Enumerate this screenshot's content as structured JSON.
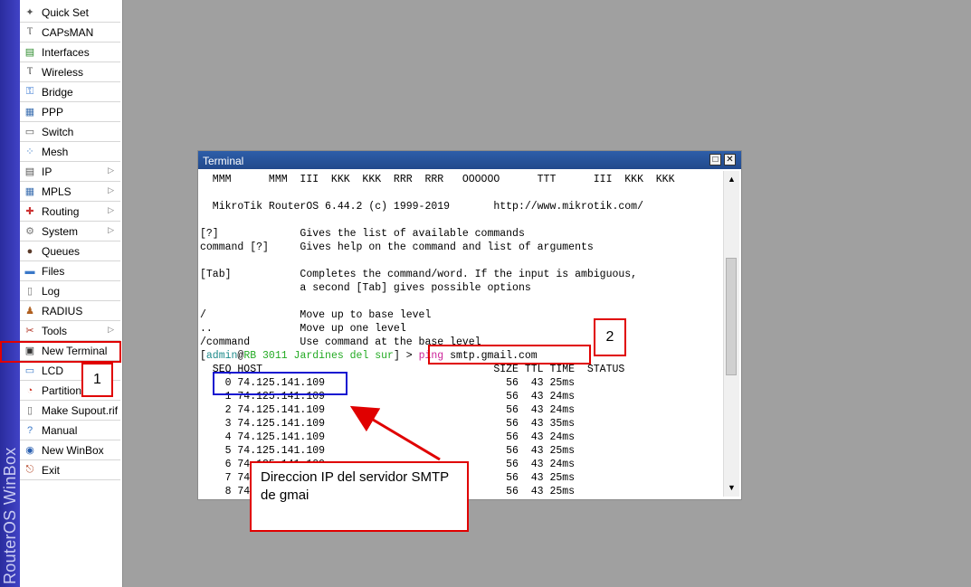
{
  "app": {
    "brand": "RouterOS WinBox"
  },
  "sidebar": {
    "items": [
      {
        "label": "Quick Set",
        "icon": "wand-icon",
        "submenu": false
      },
      {
        "label": "CAPsMAN",
        "icon": "antenna-icon",
        "submenu": false
      },
      {
        "label": "Interfaces",
        "icon": "ethernet-icon",
        "submenu": false
      },
      {
        "label": "Wireless",
        "icon": "wireless-icon",
        "submenu": false
      },
      {
        "label": "Bridge",
        "icon": "bridge-icon",
        "submenu": false
      },
      {
        "label": "PPP",
        "icon": "ppp-icon",
        "submenu": false
      },
      {
        "label": "Switch",
        "icon": "switch-icon",
        "submenu": false
      },
      {
        "label": "Mesh",
        "icon": "mesh-icon",
        "submenu": false
      },
      {
        "label": "IP",
        "icon": "ip-icon",
        "submenu": true
      },
      {
        "label": "MPLS",
        "icon": "mpls-icon",
        "submenu": true
      },
      {
        "label": "Routing",
        "icon": "routing-icon",
        "submenu": true
      },
      {
        "label": "System",
        "icon": "gear-icon",
        "submenu": true
      },
      {
        "label": "Queues",
        "icon": "queues-icon",
        "submenu": false
      },
      {
        "label": "Files",
        "icon": "folder-icon",
        "submenu": false
      },
      {
        "label": "Log",
        "icon": "log-icon",
        "submenu": false
      },
      {
        "label": "RADIUS",
        "icon": "radius-icon",
        "submenu": false
      },
      {
        "label": "Tools",
        "icon": "tools-icon",
        "submenu": true
      },
      {
        "label": "New Terminal",
        "icon": "terminal-icon",
        "submenu": false
      },
      {
        "label": "LCD",
        "icon": "lcd-icon",
        "submenu": false
      },
      {
        "label": "Partition",
        "icon": "partition-icon",
        "submenu": false
      },
      {
        "label": "Make Supout.rif",
        "icon": "document-icon",
        "submenu": false
      },
      {
        "label": "Manual",
        "icon": "manual-icon",
        "submenu": false
      },
      {
        "label": "New WinBox",
        "icon": "globe-icon",
        "submenu": false
      },
      {
        "label": "Exit",
        "icon": "exit-icon",
        "submenu": false
      }
    ]
  },
  "terminal": {
    "title": "Terminal",
    "lines": [
      "  MMM      MMM  III  KKK  KKK  RRR  RRR   OOOOOO      TTT      III  KKK  KKK",
      "",
      "  MikroTik RouterOS 6.44.2 (c) 1999-2019       http://www.mikrotik.com/",
      "",
      "[?]             Gives the list of available commands",
      "command [?]     Gives help on the command and list of arguments",
      "",
      "[Tab]           Completes the command/word. If the input is ambiguous,",
      "                a second [Tab] gives possible options",
      "",
      "/               Move up to base level",
      "..              Move up one level",
      "/command        Use command at the base level"
    ],
    "prompt": {
      "open": "[",
      "user": "admin",
      "at": "@",
      "host": "RB 3011 Jardines del sur",
      "close": "] > ",
      "command": "ping",
      "args": " smtp.gmail.com"
    },
    "ping_header": "  SEQ HOST                                     SIZE TTL TIME  STATUS",
    "ping_rows": [
      "    0 74.125.141.109                             56  43 25ms",
      "    1 74.125.141.109                             56  43 24ms",
      "    2 74.125.141.109                             56  43 24ms",
      "    3 74.125.141.109                             56  43 35ms",
      "    4 74.125.141.109                             56  43 24ms",
      "    5 74.125.141.109                             56  43 25ms",
      "    6 74.125.141.109                             56  43 24ms",
      "    7 74.125.141.109                             56  43 25ms",
      "    8 74.125.141.109                             56  43 25ms"
    ]
  },
  "annotations": {
    "step1": "1",
    "step2": "2",
    "callout": "Direccion IP del servidor SMTP de gmai"
  },
  "colors": {
    "highlight": "#e00000",
    "ip_highlight": "#1515d0",
    "titlebar": "#2d5ea9"
  }
}
